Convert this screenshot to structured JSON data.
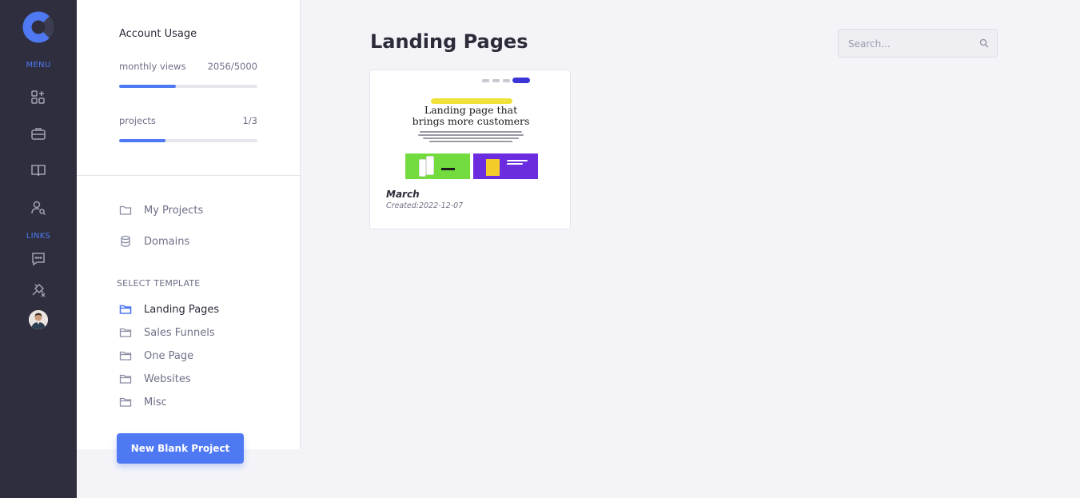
{
  "rail": {
    "menu_label": "MENU",
    "links_label": "LINKS",
    "colors": {
      "background": "#2e2e3e",
      "accent": "#4f79f2"
    },
    "icons": [
      "dashboard-icon",
      "briefcase-icon",
      "book-icon",
      "user-search-icon",
      "chat-icon",
      "plug-icon"
    ]
  },
  "usage": {
    "title": "Account Usage",
    "views_label": "monthly views",
    "views_value": "2056/5000",
    "views_progress": 0.4112,
    "projects_label": "projects",
    "projects_value": "1/3",
    "projects_progress": 0.3333
  },
  "nav": {
    "my_projects": "My Projects",
    "domains": "Domains"
  },
  "templates": {
    "heading": "SELECT TEMPLATE",
    "items": [
      "Landing Pages",
      "Sales Funnels",
      "One Page",
      "Websites",
      "Misc"
    ],
    "active": "Landing Pages"
  },
  "actions": {
    "new_project": "New Blank Project"
  },
  "main": {
    "title": "Landing Pages",
    "search_placeholder": "Search..."
  },
  "project_card": {
    "name": "March",
    "created_label": "Created:",
    "created_date": "2022-12-07",
    "thumbnail_headline_1": "Landing page that",
    "thumbnail_headline_2": "brings more customers"
  }
}
